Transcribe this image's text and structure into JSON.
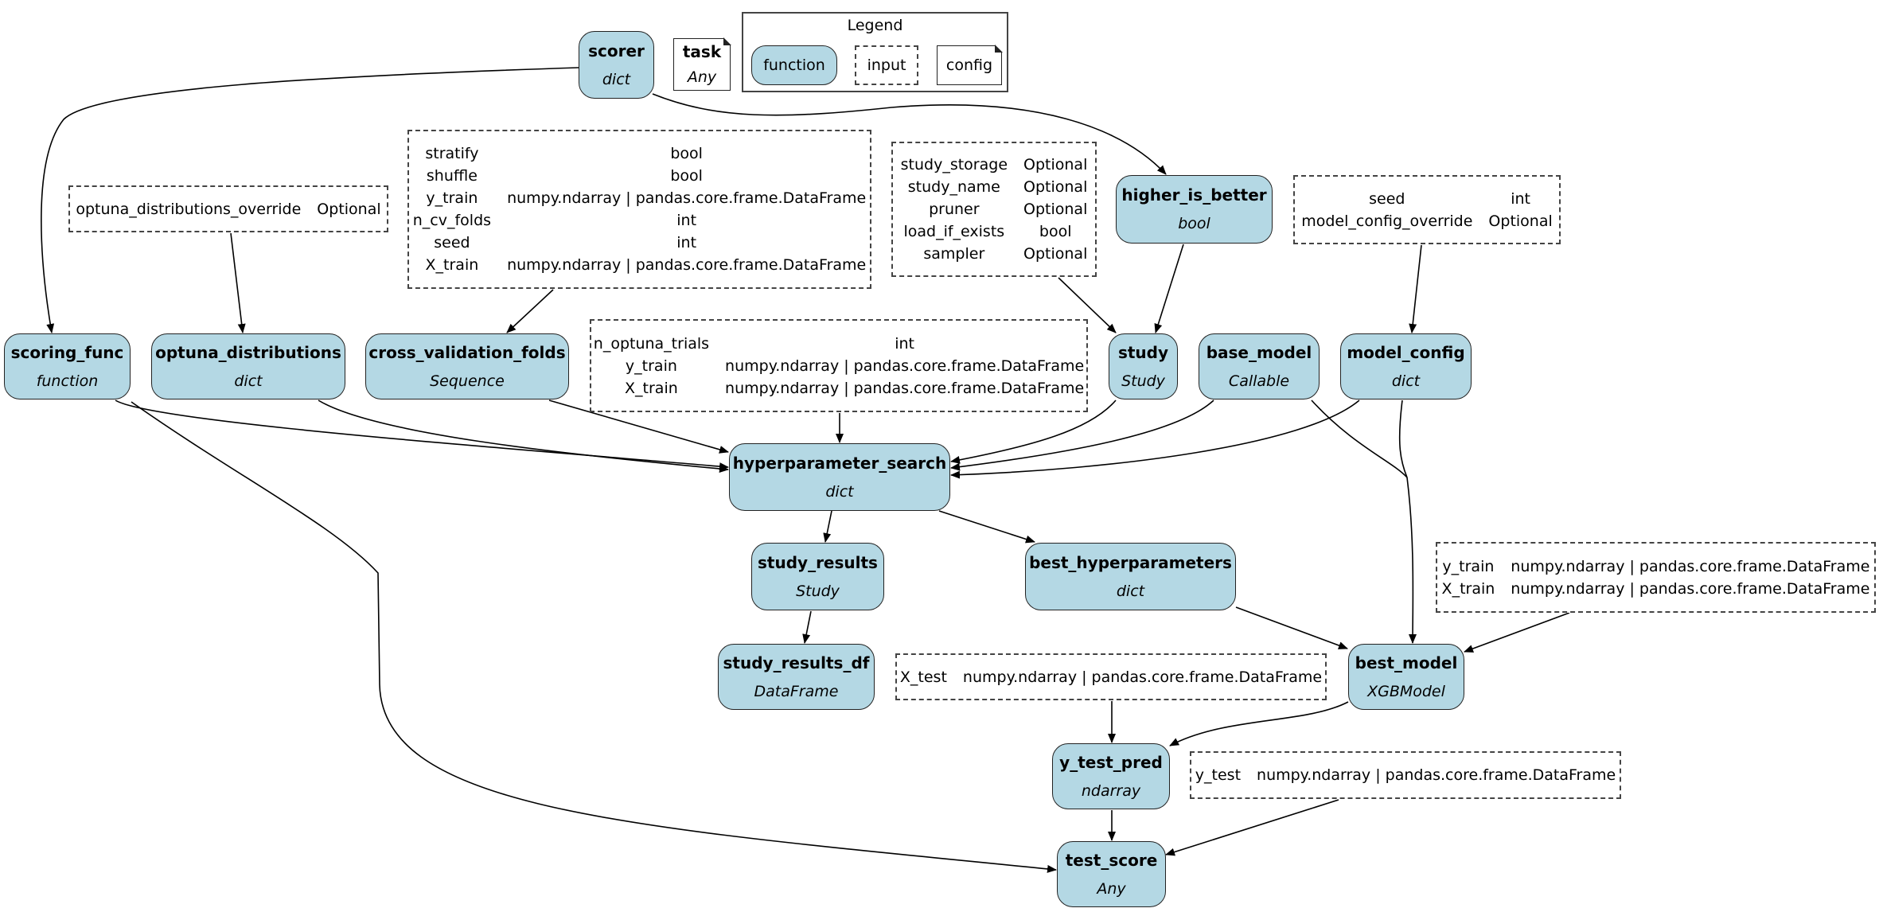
{
  "legend": {
    "title": "Legend",
    "items": [
      {
        "kind": "function",
        "label": "function"
      },
      {
        "kind": "input",
        "label": "input"
      },
      {
        "kind": "config",
        "label": "config"
      }
    ]
  },
  "colors": {
    "function_fill": "#b4d8e4",
    "border": "#222222",
    "background": "#ffffff"
  },
  "config_nodes": {
    "task": {
      "name": "task",
      "type": "Any"
    }
  },
  "function_nodes": {
    "scorer": {
      "name": "scorer",
      "type": "dict"
    },
    "higher_is_better": {
      "name": "higher_is_better",
      "type": "bool"
    },
    "scoring_func": {
      "name": "scoring_func",
      "type": "function"
    },
    "optuna_distributions": {
      "name": "optuna_distributions",
      "type": "dict"
    },
    "cross_validation_folds": {
      "name": "cross_validation_folds",
      "type": "Sequence"
    },
    "study": {
      "name": "study",
      "type": "Study"
    },
    "base_model": {
      "name": "base_model",
      "type": "Callable"
    },
    "model_config": {
      "name": "model_config",
      "type": "dict"
    },
    "hyperparameter_search": {
      "name": "hyperparameter_search",
      "type": "dict"
    },
    "study_results": {
      "name": "study_results",
      "type": "Study"
    },
    "best_hyperparameters": {
      "name": "best_hyperparameters",
      "type": "dict"
    },
    "study_results_df": {
      "name": "study_results_df",
      "type": "DataFrame"
    },
    "best_model": {
      "name": "best_model",
      "type": "XGBModel"
    },
    "y_test_pred": {
      "name": "y_test_pred",
      "type": "ndarray"
    },
    "test_score": {
      "name": "test_score",
      "type": "Any"
    }
  },
  "input_nodes": {
    "optuna_override": {
      "rows": [
        [
          "optuna_distributions_override",
          "Optional"
        ]
      ]
    },
    "cv_inputs": {
      "rows": [
        [
          "stratify",
          "bool"
        ],
        [
          "shuffle",
          "bool"
        ],
        [
          "y_train",
          "numpy.ndarray | pandas.core.frame.DataFrame"
        ],
        [
          "n_cv_folds",
          "int"
        ],
        [
          "seed",
          "int"
        ],
        [
          "X_train",
          "numpy.ndarray | pandas.core.frame.DataFrame"
        ]
      ]
    },
    "study_inputs": {
      "rows": [
        [
          "study_storage",
          "Optional"
        ],
        [
          "study_name",
          "Optional"
        ],
        [
          "pruner",
          "Optional"
        ],
        [
          "load_if_exists",
          "bool"
        ],
        [
          "sampler",
          "Optional"
        ]
      ]
    },
    "model_config_inputs": {
      "rows": [
        [
          "seed",
          "int"
        ],
        [
          "model_config_override",
          "Optional"
        ]
      ]
    },
    "search_inputs": {
      "rows": [
        [
          "n_optuna_trials",
          "int"
        ],
        [
          "y_train",
          "numpy.ndarray | pandas.core.frame.DataFrame"
        ],
        [
          "X_train",
          "numpy.ndarray | pandas.core.frame.DataFrame"
        ]
      ]
    },
    "best_model_inputs": {
      "rows": [
        [
          "y_train",
          "numpy.ndarray | pandas.core.frame.DataFrame"
        ],
        [
          "X_train",
          "numpy.ndarray | pandas.core.frame.DataFrame"
        ]
      ]
    },
    "x_test_input": {
      "rows": [
        [
          "X_test",
          "numpy.ndarray | pandas.core.frame.DataFrame"
        ]
      ]
    },
    "y_test_input": {
      "rows": [
        [
          "y_test",
          "numpy.ndarray | pandas.core.frame.DataFrame"
        ]
      ]
    }
  },
  "edges": [
    [
      "scorer",
      "scoring_func"
    ],
    [
      "scorer",
      "higher_is_better"
    ],
    [
      "optuna_override",
      "optuna_distributions"
    ],
    [
      "cv_inputs",
      "cross_validation_folds"
    ],
    [
      "study_inputs",
      "study"
    ],
    [
      "higher_is_better",
      "study"
    ],
    [
      "model_config_inputs",
      "model_config"
    ],
    [
      "scoring_func",
      "hyperparameter_search"
    ],
    [
      "optuna_distributions",
      "hyperparameter_search"
    ],
    [
      "cross_validation_folds",
      "hyperparameter_search"
    ],
    [
      "search_inputs",
      "hyperparameter_search"
    ],
    [
      "study",
      "hyperparameter_search"
    ],
    [
      "base_model",
      "hyperparameter_search"
    ],
    [
      "model_config",
      "hyperparameter_search"
    ],
    [
      "hyperparameter_search",
      "study_results"
    ],
    [
      "hyperparameter_search",
      "best_hyperparameters"
    ],
    [
      "study_results",
      "study_results_df"
    ],
    [
      "best_hyperparameters",
      "best_model"
    ],
    [
      "base_model",
      "best_model"
    ],
    [
      "model_config",
      "best_model"
    ],
    [
      "best_model_inputs",
      "best_model"
    ],
    [
      "x_test_input",
      "y_test_pred"
    ],
    [
      "best_model",
      "y_test_pred"
    ],
    [
      "y_test_pred",
      "test_score"
    ],
    [
      "y_test_input",
      "test_score"
    ],
    [
      "scoring_func",
      "test_score"
    ]
  ]
}
